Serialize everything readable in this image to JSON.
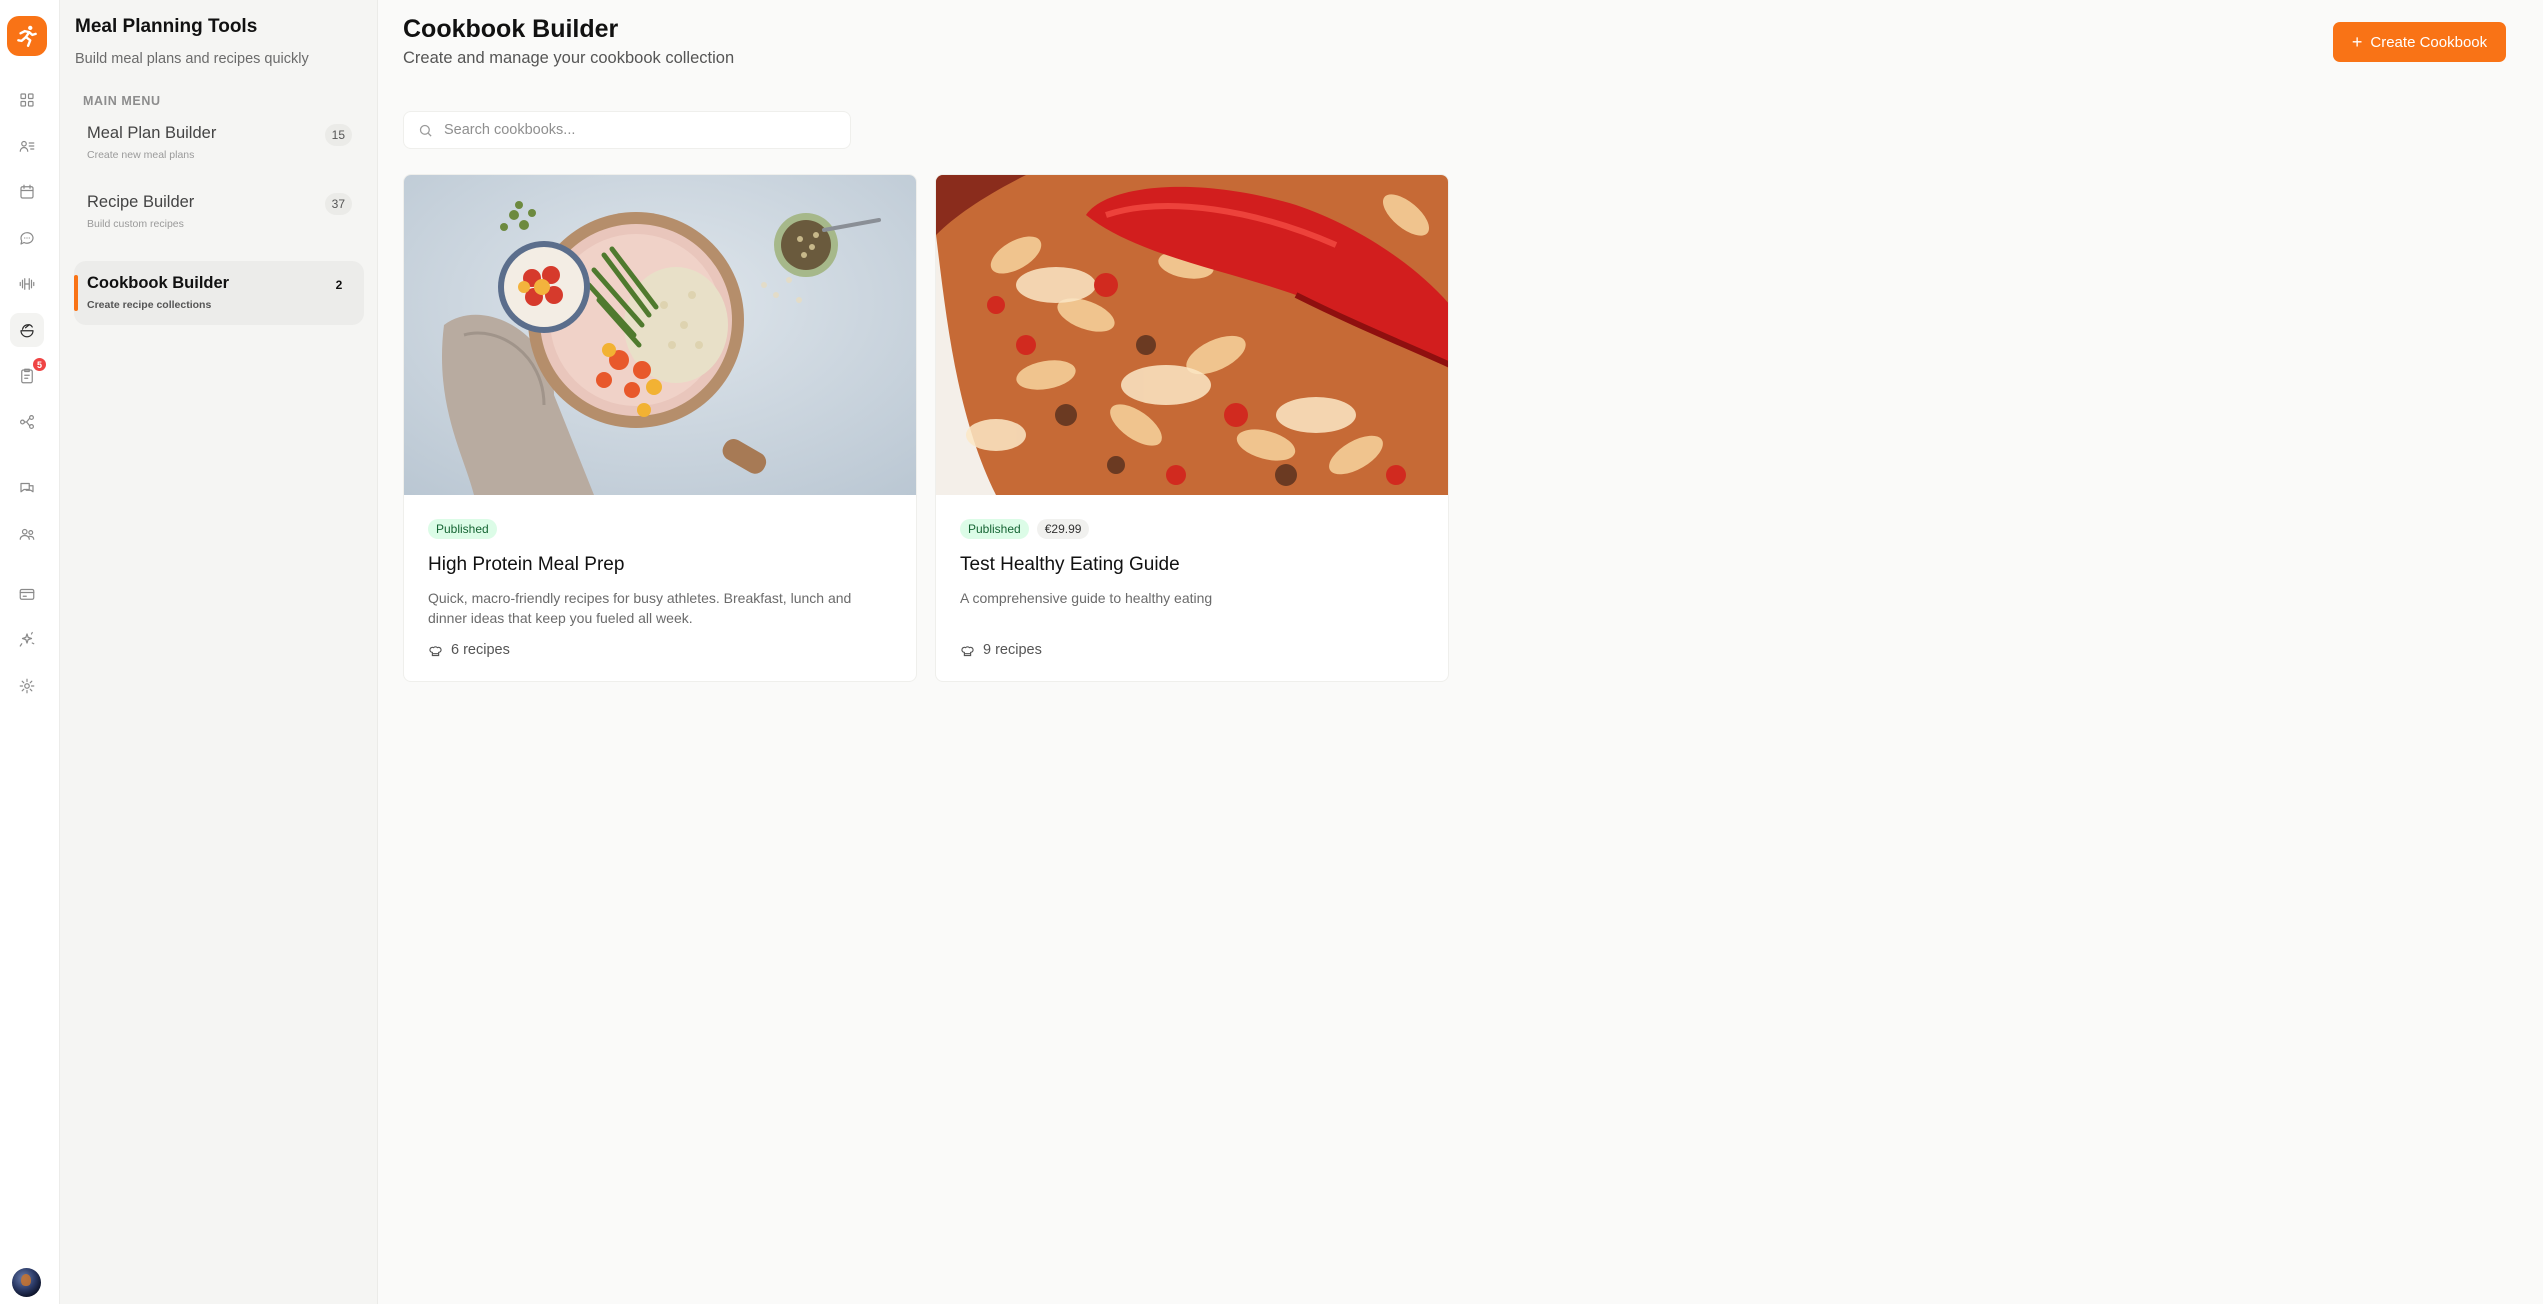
{
  "rail": {
    "logo": "running-figure-logo",
    "icons": [
      "dashboard-icon",
      "clients-icon",
      "calendar-icon",
      "messages-icon",
      "workouts-icon",
      "nutrition-icon",
      "forms-icon",
      "automation-icon",
      "chat-icon",
      "community-icon",
      "payments-icon",
      "ai-sparkles-icon",
      "settings-icon"
    ],
    "forms_badge": "5",
    "active_icon": "nutrition-icon"
  },
  "sidebar": {
    "title": "Meal Planning Tools",
    "subtitle": "Build meal plans and recipes quickly",
    "section_label": "MAIN MENU",
    "items": [
      {
        "label": "Meal Plan Builder",
        "desc": "Create new meal plans",
        "count": "15"
      },
      {
        "label": "Recipe Builder",
        "desc": "Build custom recipes",
        "count": "37"
      },
      {
        "label": "Cookbook Builder",
        "desc": "Create recipe collections",
        "count": "2"
      }
    ]
  },
  "header": {
    "title": "Cookbook Builder",
    "subtitle": "Create and manage your cookbook collection",
    "create_label": "Create Cookbook"
  },
  "search": {
    "placeholder": "Search cookbooks..."
  },
  "cards": [
    {
      "status": "Published",
      "price": "",
      "title": "High Protein Meal Prep",
      "description": "Quick, macro-friendly recipes for busy athletes. Breakfast, lunch and dinner ideas that keep you fueled all week.",
      "recipes": "6 recipes"
    },
    {
      "status": "Published",
      "price": "€29.99",
      "title": "Test Healthy Eating Guide",
      "description": "A comprehensive guide to healthy eating",
      "recipes": "9 recipes"
    }
  ],
  "colors": {
    "accent": "#f97316",
    "published_bg": "#dcfce7",
    "published_text": "#166534",
    "badge_red": "#ef4444"
  }
}
